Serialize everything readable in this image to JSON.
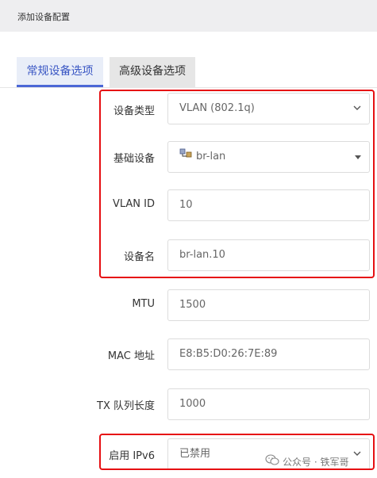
{
  "dialog": {
    "title": "添加设备配置"
  },
  "tabs": [
    {
      "label": "常规设备选项",
      "active": true
    },
    {
      "label": "高级设备选项",
      "active": false
    }
  ],
  "form": {
    "device_type": {
      "label": "设备类型",
      "value": "VLAN (802.1q)"
    },
    "base_device": {
      "label": "基础设备",
      "value": "br-lan"
    },
    "vlan_id": {
      "label": "VLAN ID",
      "value": "10"
    },
    "device_name": {
      "label": "设备名",
      "value": "br-lan.10"
    },
    "mtu": {
      "label": "MTU",
      "value": "1500"
    },
    "mac": {
      "label": "MAC 地址",
      "value": "E8:B5:D0:26:7E:89"
    },
    "txqueuelen": {
      "label": "TX 队列长度",
      "value": "1000"
    },
    "ipv6": {
      "label": "启用 IPv6",
      "value": "已禁用"
    }
  },
  "watermark": {
    "text": "公众号 · 铁军哥"
  },
  "colors": {
    "highlight": "#e60f12",
    "active_tab_text": "#3a57c4",
    "active_tab_underline": "#4b67d6"
  }
}
